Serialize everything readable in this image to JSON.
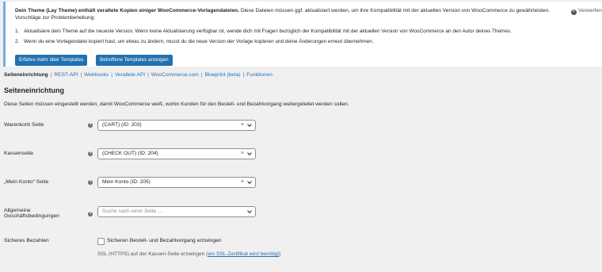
{
  "notice": {
    "title_bold": "Dein Theme (Lay Theme) enthält veraltete Kopien einiger WooCommerce-Vorlagendateien.",
    "title_rest": " Diese Dateien müssen ggf. aktualisiert werden, um ihre Kompatibilität mit der aktuellen Version von WooCommerce zu gewährleisten.",
    "subtitle": "Vorschläge zur Problembehebung:",
    "items": [
      {
        "num": "1.",
        "text": "Aktualisiere dein Theme auf die neueste Version. Wenn keine Aktualisierung verfügbar ist, wende dich mit Fragen bezüglich der Kompatibilität mit der aktuellen Version von WooCommerce an den Autor deines Themes."
      },
      {
        "num": "2.",
        "text": "Wenn du eine Vorlagendatei kopiert hast, um etwas zu ändern, musst du die neue Version der Vorlage kopieren und deine Änderungen erneut übernehmen."
      }
    ],
    "dismiss_label": "Verwerfen",
    "buttons": {
      "learn_more": "Erfahre mehr über Templates",
      "show_templates": "Betroffene Templates anzeigen"
    }
  },
  "subnav": {
    "current": "Seiteneinrichtung",
    "links": [
      "REST-API",
      "Webhooks",
      "Veraltete API",
      "WooCommerce.com",
      "Blueprint (beta)",
      "Funktionen"
    ],
    "separator": "|"
  },
  "section": {
    "title": "Seiteneinrichtung",
    "description": "Diese Seiten müssen eingestellt werden, damit WooCommerce weiß, wohin Kunden für den Bestell- und Bezahlvorgang weitergeleitet werden sollen."
  },
  "fields": {
    "cart": {
      "label": "Warenkorb Seite",
      "value": "(CART) (ID: 203)"
    },
    "checkout": {
      "label": "Kassenseite",
      "value": "(CHECK OUT) (ID: 204)"
    },
    "myaccount": {
      "label": "„Mein Konto“ Seite",
      "value": "Mein Konto (ID: 205)"
    },
    "terms": {
      "label_line1": "Allgemeine",
      "label_line2": "Geschäftsbedingungen",
      "placeholder": "Suche nach einer Seite …"
    },
    "secure": {
      "label": "Sicheres Bezahlen",
      "checkbox_label": "Sicheren Bestell- und Bezahlvorgang erzwingen",
      "checked": false,
      "ssl_text_before": "SSL (HTTPS) auf der Kassen-Seite erzwingen (",
      "ssl_link": "ein SSL-Zertifikat wird benötigt",
      "ssl_text_after": ")"
    }
  },
  "icons": {
    "help": "?",
    "clear": "×",
    "dismiss": "×"
  },
  "colors": {
    "accent": "#2271b1",
    "notice_border": "#72aee6",
    "background": "#f0f0f1"
  }
}
